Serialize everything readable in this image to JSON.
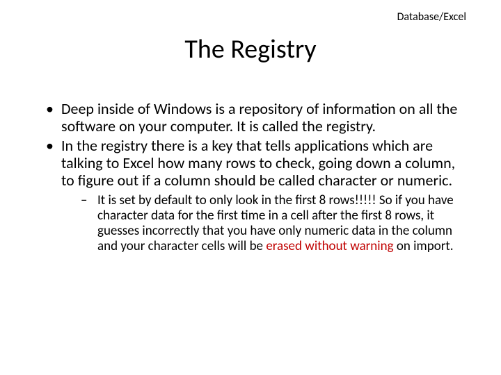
{
  "topLabel": "Database/Excel",
  "title": "The Registry",
  "bullets": {
    "first": "Deep inside of Windows is a repository of information on all the software on your computer.  It is called the registry.",
    "second": "In the registry there is a key that tells applications which are talking to Excel how many rows to check, going down a column, to figure out if a column should be called character or numeric.",
    "sub": {
      "pre": "It is set by default to only look in the first 8 rows!!!!!  So if you have character data for the first time in a cell after the first 8 rows, it guesses incorrectly that you have only numeric data in the column and your character cells will be ",
      "danger": "erased without warning",
      "post": " on import."
    }
  }
}
